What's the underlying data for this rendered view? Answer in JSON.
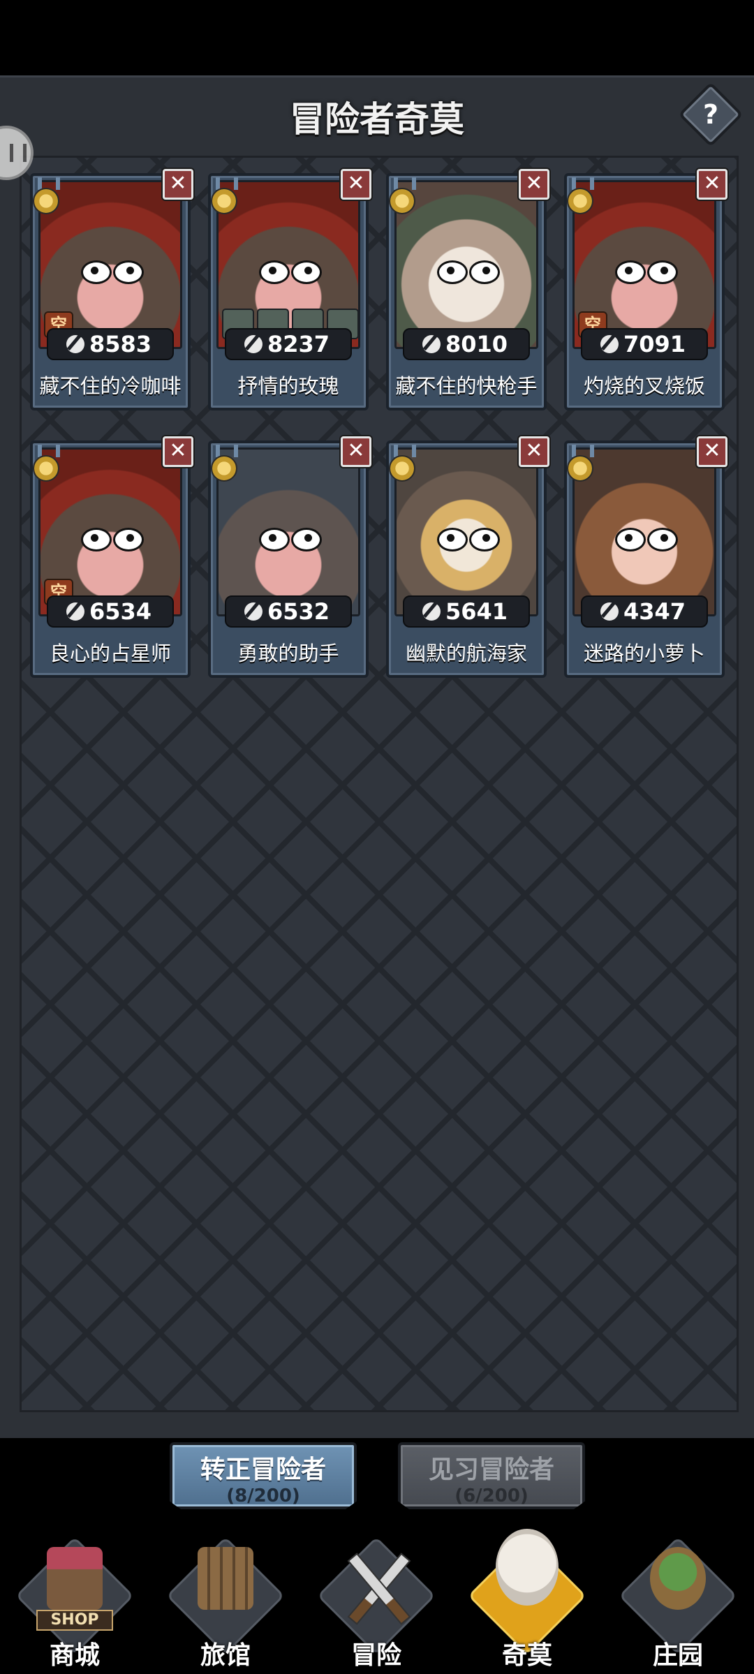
{
  "header": {
    "title": "冒险者奇莫",
    "help_label": "?"
  },
  "cards": [
    {
      "name": "藏不住的冷咖啡",
      "power": "8583",
      "portrait": "monkey",
      "badge": "空",
      "items": false
    },
    {
      "name": "抒情的玫瑰",
      "power": "8237",
      "portrait": "monkey",
      "badge": "",
      "items": true
    },
    {
      "name": "藏不住的快枪手",
      "power": "8010",
      "portrait": "frog",
      "badge": "",
      "items": false
    },
    {
      "name": "灼烧的叉烧饭",
      "power": "7091",
      "portrait": "monkey",
      "badge": "空",
      "items": false
    },
    {
      "name": "良心的占星师",
      "power": "6534",
      "portrait": "monkey",
      "badge": "空",
      "items": false
    },
    {
      "name": "勇敢的助手",
      "power": "6532",
      "portrait": "plain",
      "badge": "",
      "items": false
    },
    {
      "name": "幽默的航海家",
      "power": "5641",
      "portrait": "bear",
      "badge": "",
      "items": false
    },
    {
      "name": "迷路的小萝卜",
      "power": "4347",
      "portrait": "carrot",
      "badge": "",
      "items": false
    }
  ],
  "card_close_label": "✕",
  "tabs": [
    {
      "label": "转正冒险者",
      "count": "(8/200)",
      "active": true
    },
    {
      "label": "见习冒险者",
      "count": "(6/200)",
      "active": false
    }
  ],
  "nav": [
    {
      "label": "商城",
      "icon": "shop-icon",
      "sign": "SHOP"
    },
    {
      "label": "旅馆",
      "icon": "inn-gate-icon"
    },
    {
      "label": "冒险",
      "icon": "crossed-swords-icon"
    },
    {
      "label": "奇莫",
      "icon": "qimo-character-icon",
      "active": true
    },
    {
      "label": "庄园",
      "icon": "manor-island-icon"
    }
  ]
}
